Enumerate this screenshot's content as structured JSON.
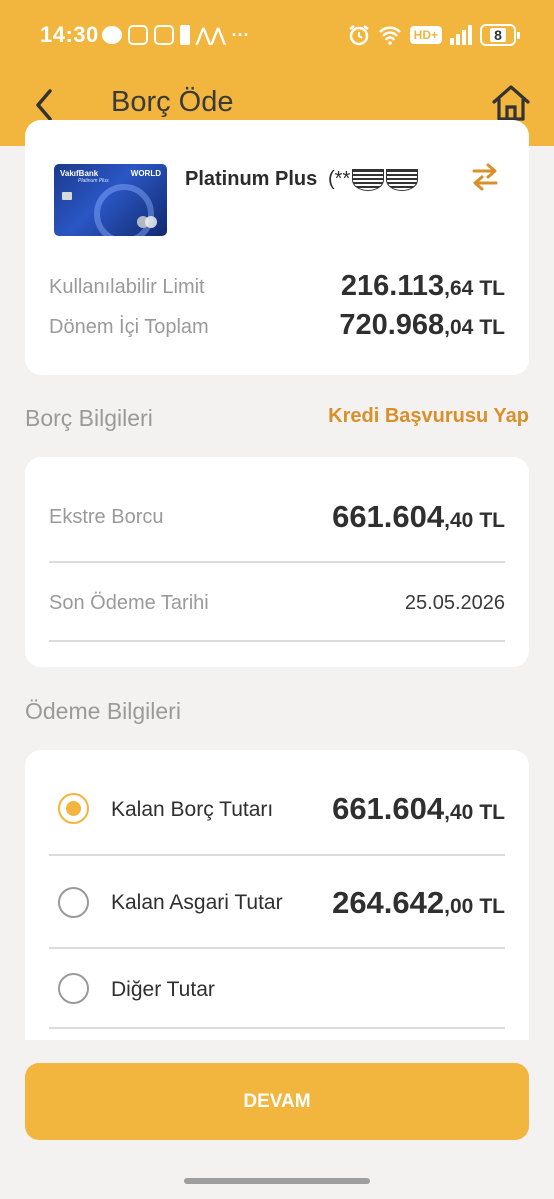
{
  "status_bar": {
    "time": "14:30",
    "more": "···",
    "hd": "HD+",
    "battery": "8"
  },
  "nav": {
    "title": "Borç Öde"
  },
  "card": {
    "bank_brand": "VakıfBank",
    "bank_sub": "Platinum Plus",
    "network_label": "WORLD",
    "name": "Platinum Plus",
    "masked_number_prefix": "(**"
  },
  "limits": {
    "available_label": "Kullanılabilir Limit",
    "available_int": "216.113",
    "available_dec": ",64",
    "period_label": "Dönem İçi Toplam",
    "period_int": "720.968",
    "period_dec": ",04",
    "currency": "TL"
  },
  "debt": {
    "section_title": "Borç Bilgileri",
    "credit_link": "Kredi Başvurusu Yap",
    "statement_label": "Ekstre Borcu",
    "statement_int": "661.604",
    "statement_dec": ",40",
    "due_label": "Son Ödeme Tarihi",
    "due_date": "25.05.2026",
    "currency": "TL"
  },
  "payment": {
    "section_title": "Ödeme Bilgileri",
    "options": [
      {
        "label": "Kalan Borç Tutarı",
        "int": "661.604",
        "dec": ",40",
        "currency": "TL",
        "selected": true
      },
      {
        "label": "Kalan Asgari Tutar",
        "int": "264.642",
        "dec": ",00",
        "currency": "TL",
        "selected": false
      },
      {
        "label": "Diğer Tutar",
        "selected": false
      }
    ]
  },
  "actions": {
    "continue_label": "DEVAM"
  },
  "colors": {
    "brand": "#f2b53d",
    "link": "#d8902a"
  }
}
